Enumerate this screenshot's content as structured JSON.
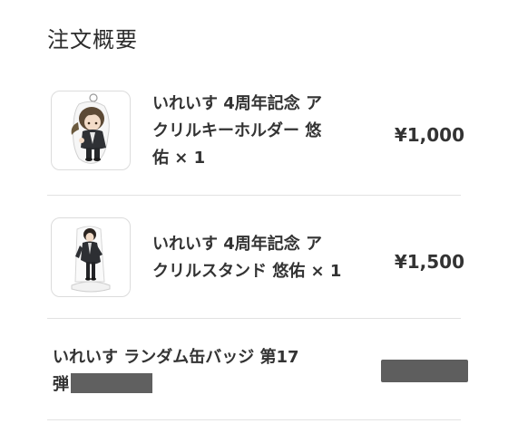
{
  "section": {
    "title": "注文概要"
  },
  "items": [
    {
      "name_line1": "いれいす 4周年記念 ア",
      "name_line2": "クリルキーホルダー 悠",
      "name_line3": "佑 × 1",
      "price": "¥1,000",
      "image_icon": "acrylic-keychain-character-image"
    },
    {
      "name_line1": "いれいす 4周年記念 ア",
      "name_line2": "クリルスタンド 悠佑 × 1",
      "price": "¥1,500",
      "image_icon": "acrylic-stand-character-image"
    },
    {
      "name_line1": "いれいす ランダム缶バッジ 第17",
      "name_line2": "弾"
    }
  ],
  "colors": {
    "divider": "#e2e2e2",
    "text": "#333333",
    "redaction": "#5e5e5e"
  }
}
